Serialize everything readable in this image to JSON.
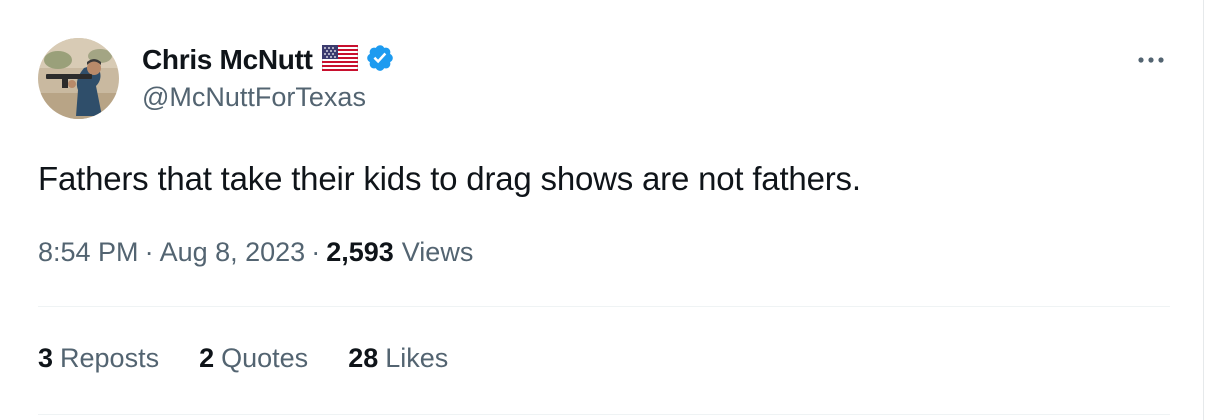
{
  "author": {
    "name": "Chris McNutt",
    "handle": "@McNuttForTexas",
    "flag_icon": "us-flag-icon",
    "verified_icon": "verified-badge-icon",
    "verified_color": "#1d9bf0"
  },
  "more_icon": "more-horizontal-icon",
  "tweet": {
    "text": "Fathers that take their kids to drag shows are not fathers."
  },
  "meta": {
    "time": "8:54 PM",
    "separator": "·",
    "date": "Aug 8, 2023",
    "views_count": "2,593",
    "views_label": "Views"
  },
  "stats": [
    {
      "count": "3",
      "label": "Reposts"
    },
    {
      "count": "2",
      "label": "Quotes"
    },
    {
      "count": "28",
      "label": "Likes"
    }
  ],
  "colors": {
    "text_primary": "#0f1419",
    "text_secondary": "#536471",
    "divider": "#eff3f4"
  }
}
